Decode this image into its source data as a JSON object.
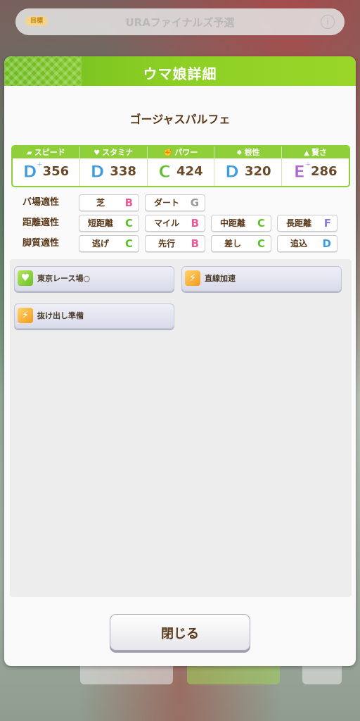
{
  "background": {
    "banner_tag": "目標",
    "banner_text": "URAファイナルズ予選",
    "banner_info": "i"
  },
  "dialog": {
    "title": "ウマ娘詳細",
    "uma_name": "ゴージャスパルフェ",
    "stats": [
      {
        "label": "スピード",
        "icon": "shoe-icon",
        "grade": "D",
        "plus": "+",
        "value": "356",
        "grade_color": "#3a9be6"
      },
      {
        "label": "スタミナ",
        "icon": "heart-icon",
        "grade": "D",
        "plus": "",
        "value": "338",
        "grade_color": "#3a9be6"
      },
      {
        "label": "パワー",
        "icon": "muscle-icon",
        "grade": "C",
        "plus": "",
        "value": "424",
        "grade_color": "#5fbf2a"
      },
      {
        "label": "根性",
        "icon": "flame-icon",
        "grade": "D",
        "plus": "",
        "value": "320",
        "grade_color": "#3a9be6"
      },
      {
        "label": "賢さ",
        "icon": "graduation-cap-icon",
        "grade": "E",
        "plus": "+",
        "value": "286",
        "grade_color": "#b066d8"
      }
    ],
    "aptitude": {
      "track": {
        "label": "バ場適性",
        "items": [
          {
            "name": "芝",
            "grade": "B",
            "color": "#ef5a9a"
          },
          {
            "name": "ダート",
            "grade": "G",
            "color": "#9a9a9a"
          }
        ]
      },
      "distance": {
        "label": "距離適性",
        "items": [
          {
            "name": "短距離",
            "grade": "C",
            "color": "#5fbf2a"
          },
          {
            "name": "マイル",
            "grade": "B",
            "color": "#ef5a9a"
          },
          {
            "name": "中距離",
            "grade": "C",
            "color": "#5fbf2a"
          },
          {
            "name": "長距離",
            "grade": "F",
            "color": "#8e7ad8"
          }
        ]
      },
      "style": {
        "label": "脚質適性",
        "items": [
          {
            "name": "逃げ",
            "grade": "C",
            "color": "#5fbf2a"
          },
          {
            "name": "先行",
            "grade": "B",
            "color": "#ef5a9a"
          },
          {
            "name": "差し",
            "grade": "C",
            "color": "#5fbf2a"
          },
          {
            "name": "追込",
            "grade": "D",
            "color": "#3a9be6"
          }
        ]
      }
    },
    "skills": [
      {
        "name": "東京レース場○",
        "icon": "heart-skill-icon",
        "icon_char": "♥"
      },
      {
        "name": "直線加速",
        "icon": "running-skill-icon",
        "icon_char": "⚡"
      },
      {
        "name": "抜け出し準備",
        "icon": "running-skill-icon",
        "icon_char": "⚡"
      }
    ],
    "close_label": "閉じる"
  }
}
